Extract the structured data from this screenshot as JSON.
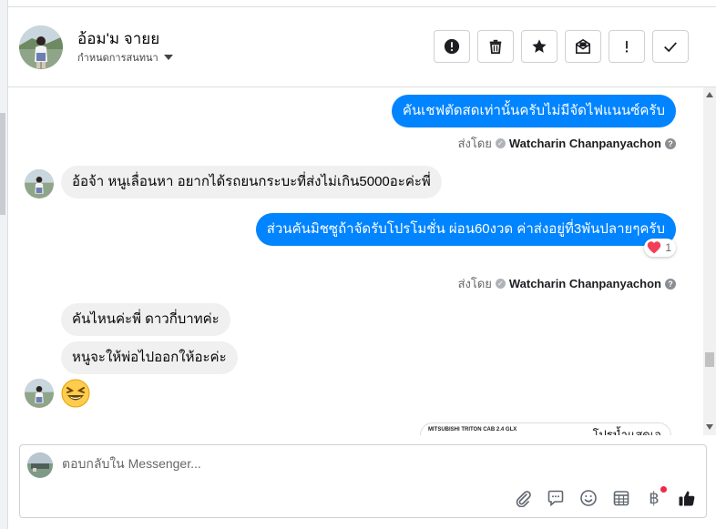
{
  "header": {
    "contact_name": "อ้อม'ม จายย",
    "assign_label": "กำหนดการสนทนา",
    "actions": [
      {
        "name": "report-button",
        "icon": "alert-circle-icon"
      },
      {
        "name": "delete-button",
        "icon": "trash-icon"
      },
      {
        "name": "star-button",
        "icon": "star-icon"
      },
      {
        "name": "mark-unread-button",
        "icon": "envelope-icon"
      },
      {
        "name": "follow-up-button",
        "icon": "exclamation-icon"
      },
      {
        "name": "done-button",
        "icon": "check-icon"
      }
    ]
  },
  "messages": {
    "m1": "คันเชฟตัดสดเท่านั้นครับไม่มีจัดไฟแนนซ์ครับ",
    "sent_by_label_1": "ส่งโดย",
    "sender_1": "Watcharin Chanpanyachon",
    "m2": "อ้อจ้า หนูเลื่อนหา อยากได้รถยนกระบะที่ส่งไม่เกิน5000อะค่ะพี่",
    "m3": "ส่วนคันมิชซูถ้าจัดรับโปรโมชั่น ผ่อน60งวด ค่าส่งอยู่ที่3พันปลายๆครับ",
    "m3_reaction_count": "1",
    "sent_by_label_2": "ส่งโดย",
    "sender_2": "Watcharin Chanpanyachon",
    "m4": "คันไหนค่ะพี่ ดาวกี่บาทค่ะ",
    "m5": "หนูจะให้พ่อไปออกให้อะค่ะ",
    "m6_emoji": "laughing-face-icon",
    "attachment_caption": "MITSUBISHI TRITON CAB 2.4 GLX",
    "attachment_text": "โปรน้ำแสดเอ"
  },
  "composer": {
    "placeholder": "ตอบกลับใน Messenger...",
    "value": ""
  },
  "colors": {
    "outgoing_bubble": "#0084ff",
    "incoming_bubble": "#f0f0f0",
    "reaction_heart": "#f33e58",
    "notification_dot": "#f02849"
  }
}
